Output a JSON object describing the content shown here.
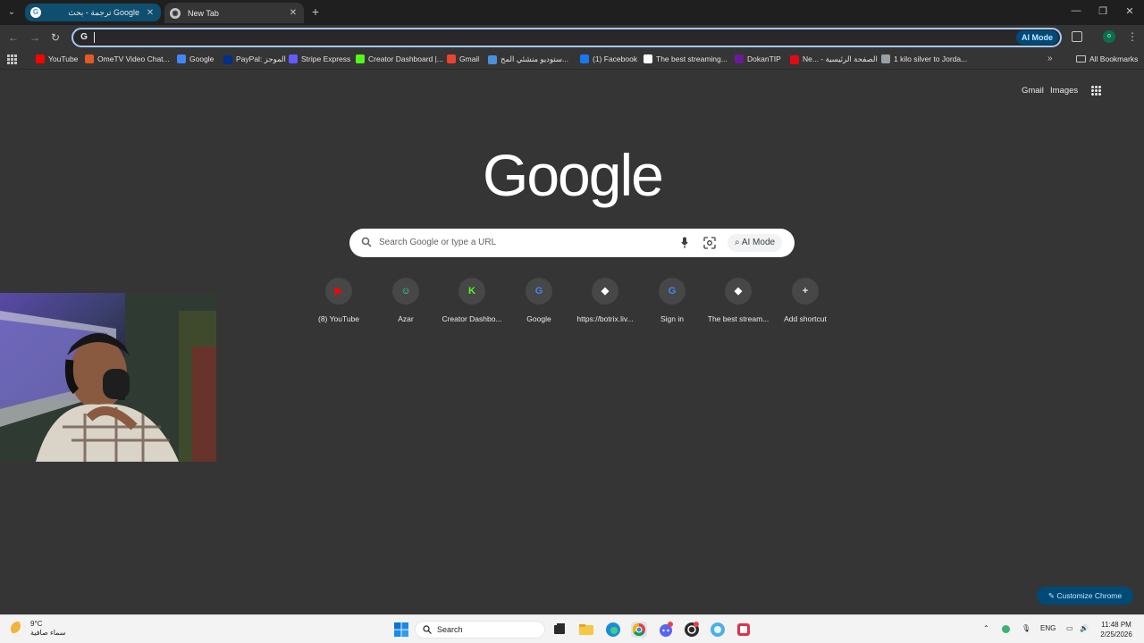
{
  "tabs": [
    {
      "title": "ترجمة - بحث Google",
      "favicon": "google-icon",
      "active": false
    },
    {
      "title": "New Tab",
      "favicon": "chrome-icon",
      "active": true
    }
  ],
  "toolbar": {
    "omnibox_value": "",
    "ai_mode_label": "AI Mode",
    "profile_initial": "o"
  },
  "bookmarks": [
    {
      "label": "YouTube",
      "color": "#ff0000"
    },
    {
      "label": "OmeTV Video Chat...",
      "color": "#e05a28"
    },
    {
      "label": "Google",
      "color": "#4285f4"
    },
    {
      "label": "PayPal: الموجز",
      "color": "#003087"
    },
    {
      "label": "Stripe Express",
      "color": "#635bff"
    },
    {
      "label": "Creator Dashboard |...",
      "color": "#53fc18"
    },
    {
      "label": "Gmail",
      "color": "#ea4335"
    },
    {
      "label": "ستوديو منشئي المح...",
      "color": "#4a90d9"
    },
    {
      "label": "(1) Facebook",
      "color": "#1877f2"
    },
    {
      "label": "The best streaming...",
      "color": "#ffffff"
    },
    {
      "label": "DokanTIP",
      "color": "#6a1b9a"
    },
    {
      "label": "Ne... - الصفحة الرئيسية",
      "color": "#e50914"
    },
    {
      "label": "1 kilo silver to Jorda...",
      "color": "#9aa0a6"
    }
  ],
  "all_bookmarks_label": "All Bookmarks",
  "ntp": {
    "gmail_label": "Gmail",
    "images_label": "Images",
    "logo_text": "Google",
    "search_placeholder": "Search Google or type a URL",
    "ai_mode_label": "AI Mode",
    "shortcuts": [
      {
        "label": "(8) YouTube",
        "glyph": "▶",
        "color": "#ff0000"
      },
      {
        "label": "Azar",
        "glyph": "☺",
        "color": "#2ee59d"
      },
      {
        "label": "Creator Dashbo...",
        "glyph": "K",
        "color": "#53fc18"
      },
      {
        "label": "Google",
        "glyph": "G",
        "color": "#4285f4"
      },
      {
        "label": "https://botrix.liv...",
        "glyph": "◆",
        "color": "#ffffff"
      },
      {
        "label": "Sign in",
        "glyph": "G",
        "color": "#4285f4"
      },
      {
        "label": "The best stream...",
        "glyph": "◆",
        "color": "#ffffff"
      },
      {
        "label": "Add shortcut",
        "glyph": "+",
        "color": "#e8eaed"
      }
    ],
    "customize_label": "Customize Chrome"
  },
  "taskbar": {
    "temperature": "9°C",
    "weather_desc": "سماء صافية",
    "search_label": "Search",
    "language": "ENG",
    "time": "11:48 PM",
    "date": "2/25/2026"
  }
}
